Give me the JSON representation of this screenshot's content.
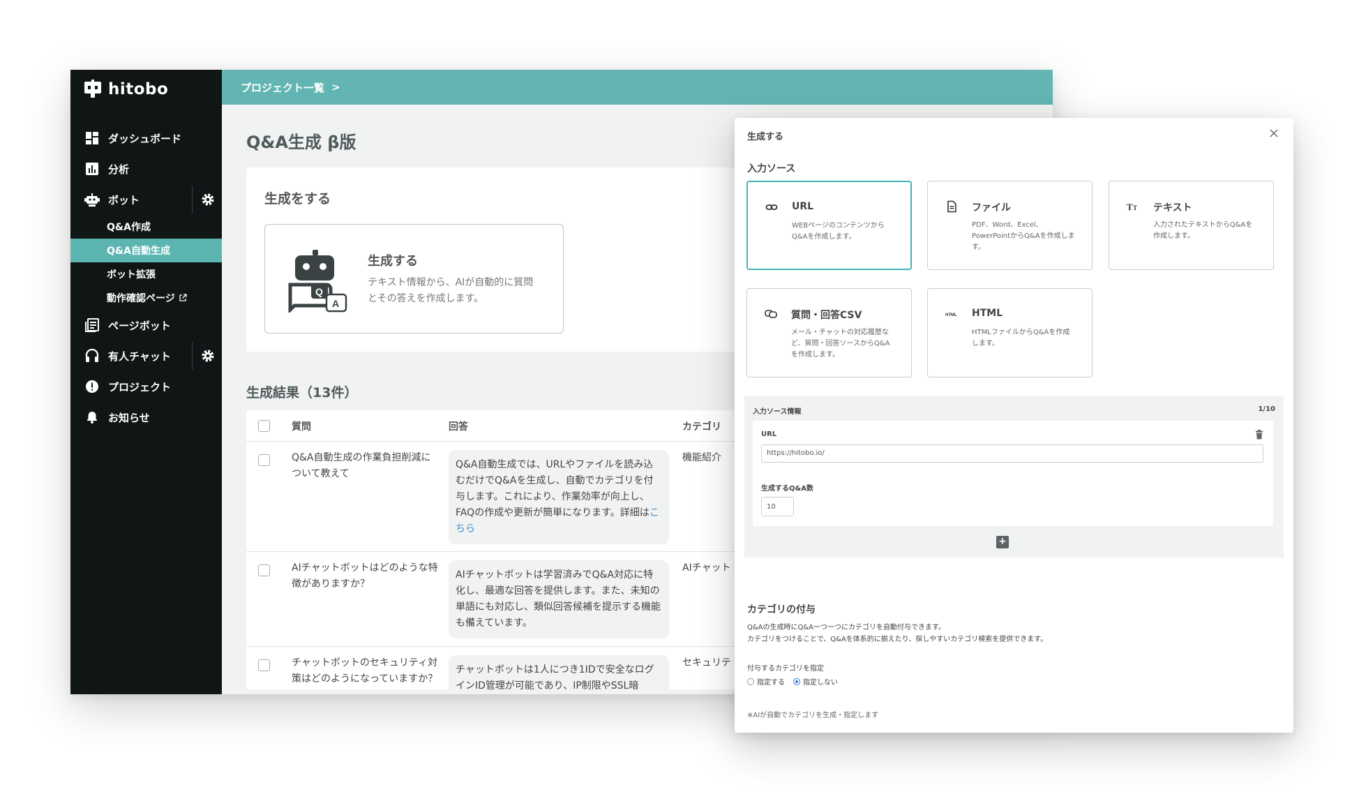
{
  "app": {
    "logo_text": "hitobo"
  },
  "sidebar": {
    "items": [
      {
        "label": "ダッシュボード",
        "icon": "dashboard-icon"
      },
      {
        "label": "分析",
        "icon": "analytics-icon"
      },
      {
        "label": "ボット",
        "icon": "bot-icon"
      },
      {
        "label": "ページボット",
        "icon": "pagebot-icon"
      },
      {
        "label": "有人チャット",
        "icon": "headset-icon"
      },
      {
        "label": "プロジェクト",
        "icon": "alert-icon"
      },
      {
        "label": "お知らせ",
        "icon": "bell-icon"
      }
    ],
    "bot_sub": [
      {
        "label": "Q&A作成"
      },
      {
        "label": "Q&A自動生成"
      },
      {
        "label": "ボット拡張"
      },
      {
        "label": "動作確認ページ"
      }
    ]
  },
  "topbar": {
    "breadcrumb": "プロジェクト一覧",
    "separator": ">"
  },
  "main": {
    "title": "Q&A生成 β版",
    "gen_section_title": "生成をする",
    "gen_box_title": "生成する",
    "gen_box_desc": "テキスト情報から、AIが自動的に質問とその答えを作成します。",
    "results_title": "生成結果（13件）",
    "table": {
      "headers": {
        "question": "質問",
        "answer": "回答",
        "category": "カテゴリ"
      },
      "rows": [
        {
          "question": "Q&A自動生成の作業負担削減について教えて",
          "answer": "Q&A自動生成では、URLやファイルを読み込むだけでQ&Aを生成し、自動でカテゴリを付与します。これにより、作業効率が向上し、FAQの作成や更新が簡単になります。詳細は",
          "answer_link": "こちら",
          "category": "機能紹介"
        },
        {
          "question": "AIチャットボットはどのような特徴がありますか？",
          "answer": "AIチャットボットは学習済みでQ&A対応に特化し、最適な回答を提供します。また、未知の単語にも対応し、類似回答候補を提示する機能も備えています。",
          "answer_link": "",
          "category": "AIチャット"
        },
        {
          "question": "チャットボットのセキュリティ対策はどのようになっていますか？",
          "answer": "チャットボットは1人につき1IDで安全なログインID管理が可能であり、IP制限やSSL暗",
          "answer_link": "",
          "category": "セキュリテ"
        }
      ]
    }
  },
  "modal": {
    "title": "生成する",
    "source_label": "入力ソース",
    "sources": [
      {
        "title": "URL",
        "desc": "WEBページのコンテンツからQ&Aを作成します。",
        "icon": "link-icon",
        "selected": true
      },
      {
        "title": "ファイル",
        "desc": "PDF、Word、Excel、PowerPointからQ&Aを作成します。",
        "icon": "file-icon",
        "selected": false
      },
      {
        "title": "テキスト",
        "desc": "入力されたテキストからQ&Aを作成します。",
        "icon": "text-icon",
        "selected": false
      },
      {
        "title": "質問・回答CSV",
        "desc": "メール・チャットの対応履歴など、質問・回答ソースからQ&Aを作成します。",
        "icon": "chat-csv-icon",
        "selected": false
      },
      {
        "title": "HTML",
        "desc": "HTMLファイルからQ&Aを作成します。",
        "icon": "html-icon",
        "selected": false
      }
    ],
    "info": {
      "label": "入力ソース情報",
      "count": "1/10",
      "url_label": "URL",
      "url_value": "https://hitobo.io/",
      "num_label": "生成するQ&A数",
      "num_value": "10"
    },
    "category": {
      "title": "カテゴリの付与",
      "desc1": "Q&Aの生成時にQ&A一つ一つにカテゴリを自動付与できます。",
      "desc2": "カテゴリをつけることで、Q&Aを体系的に揃えたり、探しやすいカテゴリ検索を提供できます。",
      "spec_label": "付与するカテゴリを指定",
      "option_specify": "指定する",
      "option_none": "指定しない",
      "selected": "指定しない",
      "note": "※AIが自動でカテゴリを生成・指定します"
    }
  },
  "colors": {
    "sidebar_bg": "#101516",
    "accent": "#5db5b2",
    "topbar": "#62b5b3",
    "selected_border": "#43b3b0",
    "link": "#3d8fd0"
  }
}
